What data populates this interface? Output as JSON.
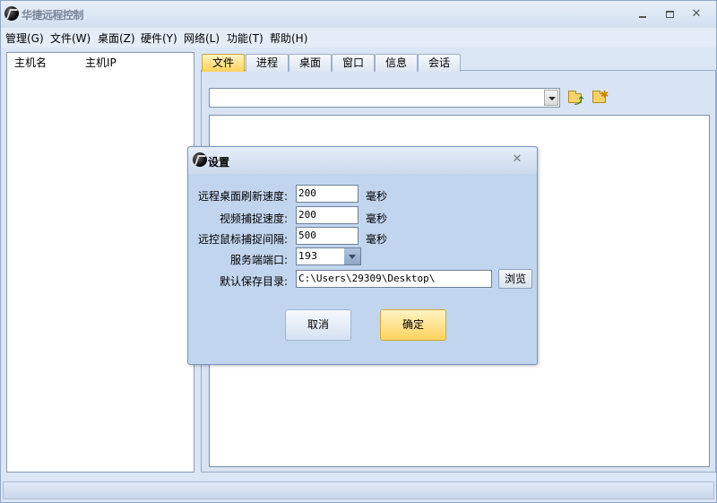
{
  "app": {
    "title": "华捷远程控制"
  },
  "menu": {
    "items": [
      "管理(G)",
      "文件(W)",
      "桌面(Z)",
      "硬件(Y)",
      "网络(L)",
      "功能(T)",
      "帮助(H)"
    ]
  },
  "host_list": {
    "columns": [
      "主机名",
      "主机IP"
    ]
  },
  "tabs": [
    "文件",
    "进程",
    "桌面",
    "窗口",
    "信息",
    "会话"
  ],
  "file_browser": {
    "path_value": ""
  },
  "dialog": {
    "title": "设置",
    "fields": {
      "refresh_label": "远程桌面刷新速度:",
      "refresh_value": "200",
      "refresh_unit": "毫秒",
      "video_label": "视频捕捉速度:",
      "video_value": "200",
      "video_unit": "毫秒",
      "mouse_label": "远控鼠标捕捉间隔:",
      "mouse_value": "500",
      "mouse_unit": "毫秒",
      "port_label": "服务端端口:",
      "port_value": "193",
      "dir_label": "默认保存目录:",
      "dir_value": "C:\\Users\\29309\\Desktop\\"
    },
    "browse_label": "浏览",
    "cancel_label": "取消",
    "ok_label": "确定"
  },
  "colors": {
    "active_tab": "#ffd15a",
    "ok_button": "#ffd35e",
    "window_bg": "#dbe6f4"
  }
}
